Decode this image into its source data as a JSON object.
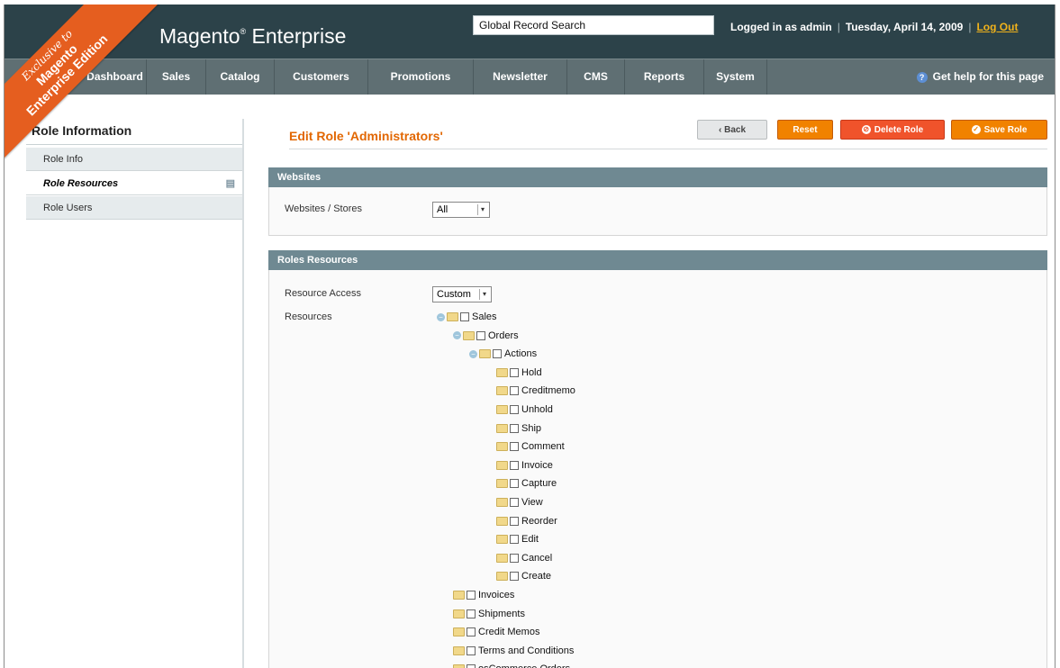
{
  "header": {
    "brand": "Magento",
    "brand_suffix": "Enterprise",
    "search_value": "Global Record Search",
    "logged_in": "Logged in as admin",
    "date": "Tuesday, April 14, 2009",
    "logout": "Log Out"
  },
  "nav": {
    "items": [
      "Dashboard",
      "Sales",
      "Catalog",
      "Customers",
      "Promotions",
      "Newsletter",
      "CMS",
      "Reports",
      "System"
    ],
    "help": "Get help for this page"
  },
  "ribbon": {
    "line1": "Exclusive to",
    "line2": "Magento",
    "line3": "Enterprise Edition"
  },
  "sidebar": {
    "title": "Role Information",
    "items": [
      {
        "label": "Role Info"
      },
      {
        "label": "Role Resources"
      },
      {
        "label": "Role Users"
      }
    ]
  },
  "page": {
    "title": "Edit Role 'Administrators'",
    "buttons": {
      "back": "Back",
      "reset": "Reset",
      "delete": "Delete Role",
      "save": "Save Role"
    }
  },
  "websites": {
    "header": "Websites",
    "label": "Websites / Stores",
    "value": "All"
  },
  "resources": {
    "header": "Roles Resources",
    "access_label": "Resource Access",
    "access_value": "Custom",
    "resources_label": "Resources",
    "tree": [
      {
        "label": "Sales",
        "level": 0,
        "expanded": true
      },
      {
        "label": "Orders",
        "level": 1,
        "expanded": true
      },
      {
        "label": "Actions",
        "level": 2,
        "expanded": true
      },
      {
        "label": "Hold",
        "level": 3
      },
      {
        "label": "Creditmemo",
        "level": 3
      },
      {
        "label": "Unhold",
        "level": 3
      },
      {
        "label": "Ship",
        "level": 3
      },
      {
        "label": "Comment",
        "level": 3
      },
      {
        "label": "Invoice",
        "level": 3
      },
      {
        "label": "Capture",
        "level": 3
      },
      {
        "label": "View",
        "level": 3
      },
      {
        "label": "Reorder",
        "level": 3
      },
      {
        "label": "Edit",
        "level": 3
      },
      {
        "label": "Cancel",
        "level": 3
      },
      {
        "label": "Create",
        "level": 3
      },
      {
        "label": "Invoices",
        "level": 1
      },
      {
        "label": "Shipments",
        "level": 1
      },
      {
        "label": "Credit Memos",
        "level": 1
      },
      {
        "label": "Terms and Conditions",
        "level": 1
      },
      {
        "label": "osCommerce Orders",
        "level": 1
      }
    ]
  }
}
